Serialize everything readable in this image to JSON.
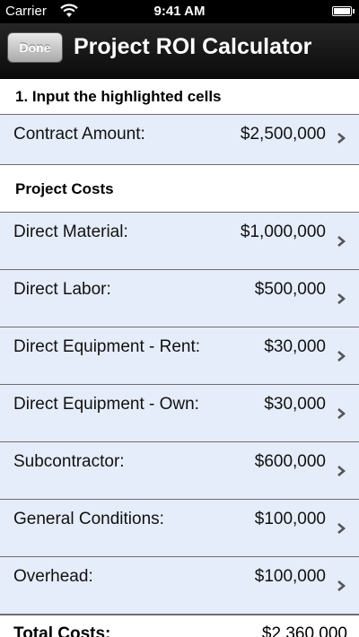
{
  "status_bar": {
    "carrier": "Carrier",
    "time": "9:41 AM",
    "wifi_icon": "wifi-icon",
    "battery_icon": "battery-icon"
  },
  "nav": {
    "done_label": "Done",
    "title": "Project ROI Calculator"
  },
  "sections": {
    "input_header": "1. Input the highlighted cells",
    "costs_header": "Project Costs"
  },
  "contract": {
    "label": "Contract Amount:",
    "value": "$2,500,000"
  },
  "cost_items": [
    {
      "label": "Direct Material:",
      "value": "$1,000,000"
    },
    {
      "label": "Direct Labor:",
      "value": "$500,000"
    },
    {
      "label": "Direct Equipment - Rent:",
      "value": "$30,000"
    },
    {
      "label": "Direct Equipment - Own:",
      "value": "$30,000"
    },
    {
      "label": "Subcontractor:",
      "value": "$600,000"
    },
    {
      "label": "General Conditions:",
      "value": "$100,000"
    },
    {
      "label": "Overhead:",
      "value": "$100,000"
    }
  ],
  "total": {
    "label": "Total Costs:",
    "value": "$2,360,000"
  },
  "colors": {
    "highlight_row": "#e6edfa",
    "nav_bar": "#1a1a1a",
    "separator": "#6e6e6e"
  }
}
